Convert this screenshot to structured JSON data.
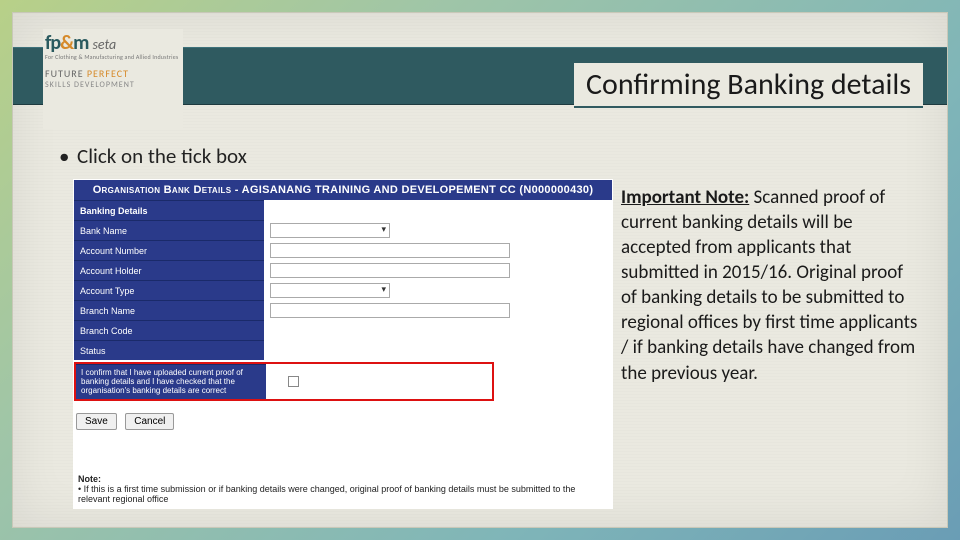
{
  "title": "Confirming Banking details",
  "bullet": "Click on the tick box",
  "logo": {
    "fp": "fp",
    "amp": "&",
    "m": "m",
    "seta": "seta",
    "small": "For Clothing & Manufacturing and Allied Industries",
    "future": "FUTURE ",
    "perfect": "PERFECT",
    "skills": "SKILLS DEVELOPMENT"
  },
  "form": {
    "header": "Organisation Bank Details - AGISANANG TRAINING AND DEVELOPEMENT CC (N000000430)",
    "section": "Banking Details",
    "labels": {
      "bank_name": "Bank Name",
      "account_number": "Account Number",
      "account_holder": "Account Holder",
      "account_type": "Account Type",
      "branch_name": "Branch Name",
      "branch_code": "Branch Code",
      "status": "Status"
    },
    "confirm_text": "I confirm that I have uploaded current proof of banking details and I have checked that the organisation's banking details are correct",
    "buttons": {
      "save": "Save",
      "cancel": "Cancel"
    },
    "note_heading": "Note:",
    "note_line": "If this is a first time submission or if banking details were changed, original proof of banking details must be submitted to the relevant regional office"
  },
  "side_note": {
    "heading": "Important Note:",
    "body": " Scanned proof of current banking details will be accepted from applicants that submitted in 2015/16. Original proof of banking details to be submitted to regional offices by first time applicants / if banking details have changed from the previous year."
  }
}
